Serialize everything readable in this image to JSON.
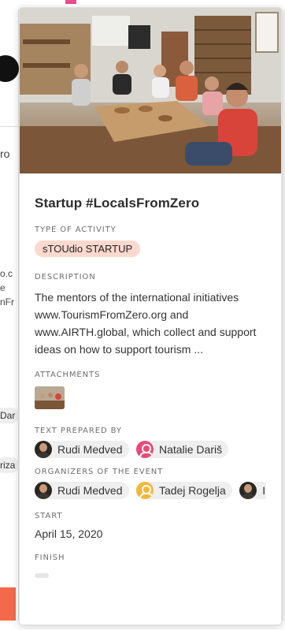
{
  "background": {
    "fragments": [
      "ro",
      "o.c",
      "e",
      "nFr"
    ],
    "pills": [
      "Dar",
      "riza"
    ]
  },
  "event": {
    "title": "Startup #LocalsFromZero",
    "type_label": "TYPE OF ACTIVITY",
    "type_value": "sTOUdio STARTUP",
    "description_label": "DESCRIPTION",
    "description": "The mentors of the international initiatives www.TourismFromZero.org and www.AIRTH.global, which collect and support ideas on how to support tourism ...",
    "attachments_label": "ATTACHMENTS",
    "text_prepared_label": "TEXT PREPARED BY",
    "text_prepared_by": [
      {
        "name": "Rudi Medved",
        "avatar": "photo"
      },
      {
        "name": "Natalie Dariš",
        "avatar": "user-icon-pink"
      }
    ],
    "organizers_label": "ORGANIZERS OF THE EVENT",
    "organizers": [
      {
        "name": "Rudi Medved",
        "avatar": "photo"
      },
      {
        "name": "Tadej Rogelja",
        "avatar": "user-icon-yellow"
      },
      {
        "name": "I",
        "avatar": "photo"
      }
    ],
    "start_label": "START",
    "start_value": "April 15, 2020",
    "finish_label": "FINISH"
  },
  "colors": {
    "tag_bg": "#fbd9cf",
    "accent_pink": "#e84a77",
    "accent_yellow": "#f3b73a",
    "accent_orange": "#f26a4b"
  }
}
